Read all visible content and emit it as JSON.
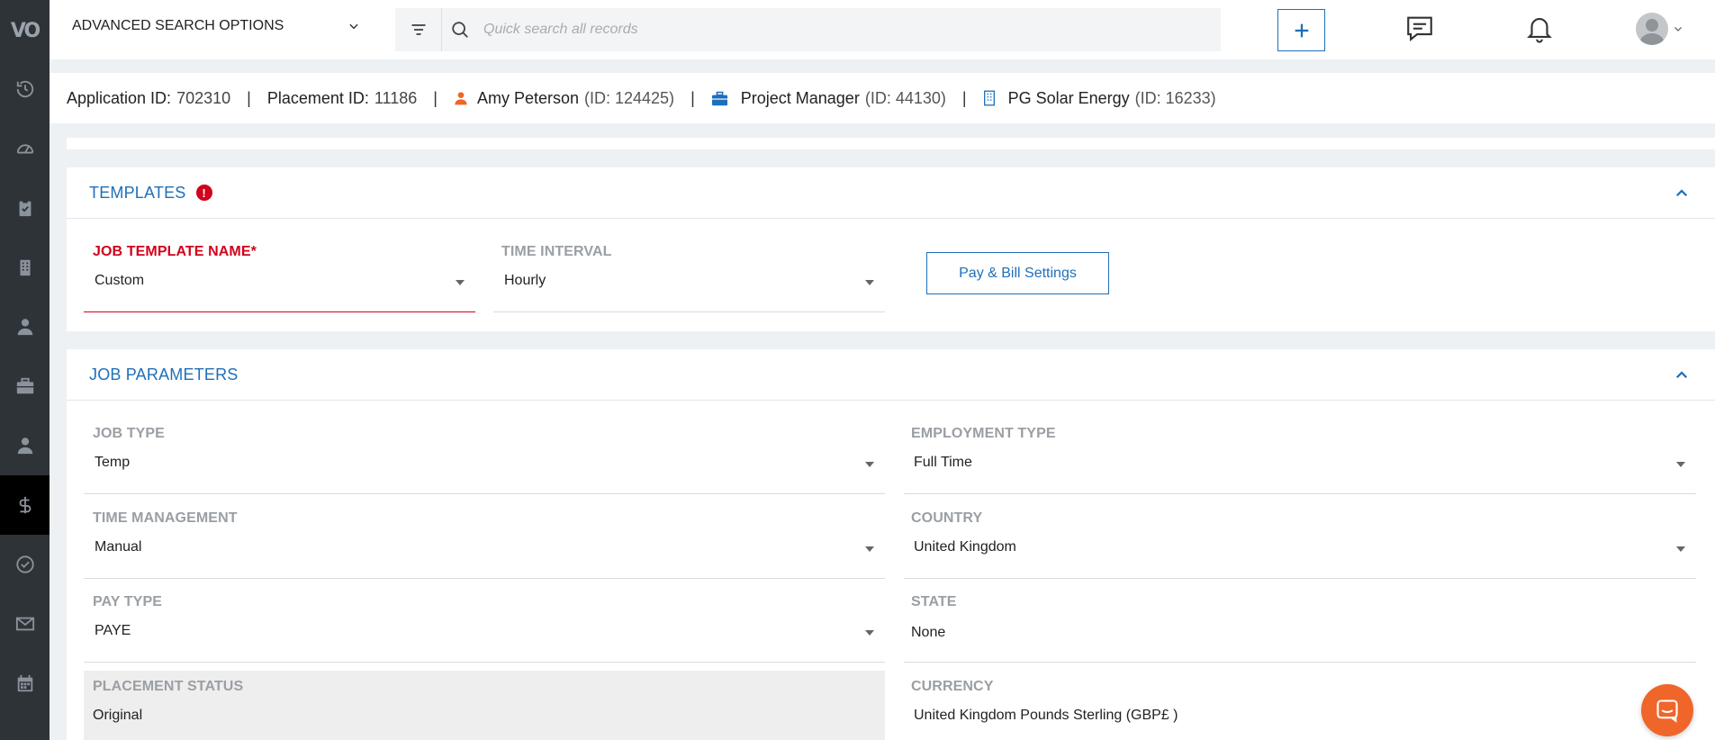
{
  "header": {
    "advanced_search_label": "ADVANCED SEARCH OPTIONS",
    "search_placeholder": "Quick search all records"
  },
  "infobar": {
    "application_label": "Application ID:",
    "application_id": "702310",
    "placement_label": "Placement ID:",
    "placement_id": "11186",
    "separator": "|",
    "candidate_name": "Amy Peterson",
    "candidate_id": "(ID: 124425)",
    "job_title": "Project Manager",
    "job_id": "(ID: 44130)",
    "company_name": "PG Solar Energy",
    "company_id": "(ID: 16233)"
  },
  "templates": {
    "title": "TEMPLATES",
    "warning": "!",
    "job_template": {
      "label": "JOB TEMPLATE NAME",
      "required_mark": "*",
      "value": "Custom"
    },
    "time_interval": {
      "label": "TIME INTERVAL",
      "value": "Hourly"
    },
    "pay_bill_button": "Pay & Bill Settings"
  },
  "job_parameters": {
    "title": "JOB PARAMETERS",
    "job_type": {
      "label": "JOB TYPE",
      "value": "Temp"
    },
    "employment_type": {
      "label": "EMPLOYMENT TYPE",
      "value": "Full Time"
    },
    "time_management": {
      "label": "TIME MANAGEMENT",
      "value": "Manual"
    },
    "country": {
      "label": "COUNTRY",
      "value": "United Kingdom"
    },
    "pay_type": {
      "label": "PAY TYPE",
      "value": "PAYE"
    },
    "state": {
      "label": "STATE",
      "value": "None"
    },
    "placement_status": {
      "label": "PLACEMENT STATUS",
      "value": "Original"
    },
    "currency": {
      "label": "CURRENCY",
      "value": "United Kingdom Pounds Sterling (GBP£ )"
    }
  },
  "sidebar": {
    "logo": "VO",
    "items": [
      "history-icon",
      "dashboard-icon",
      "clipboard-check-icon",
      "building-icon",
      "user-tie-icon",
      "briefcase-icon",
      "user-icon",
      "dollar-icon",
      "check-circle-icon",
      "mail-icon",
      "calendar-icon"
    ],
    "active_item": "dollar-icon"
  },
  "colors": {
    "accent": "#1f6fb8",
    "error": "#d0021b",
    "sidebar": "#2e3338",
    "fab": "#f0652a"
  }
}
